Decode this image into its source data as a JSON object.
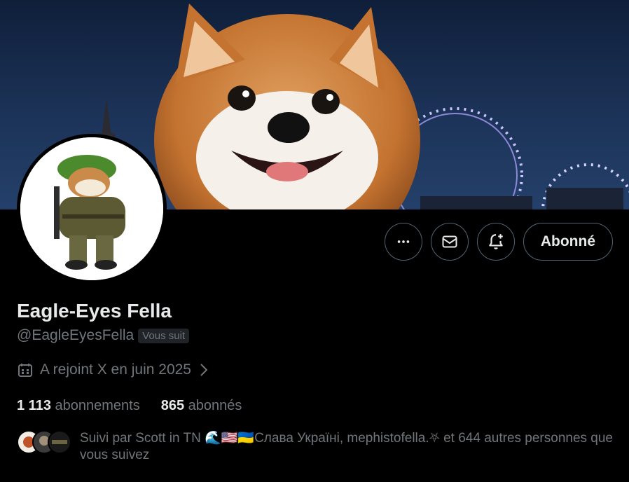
{
  "profile": {
    "name": "Eagle-Eyes Fella",
    "handle": "@EagleEyesFella",
    "follows_you": "Vous suit",
    "joined": "A rejoint X en juin 2025"
  },
  "actions": {
    "more_icon": "more-icon",
    "message_icon": "mail-icon",
    "notify_icon": "bell-plus-icon",
    "follow_label": "Abonné"
  },
  "stats": {
    "following_count": "1 113",
    "following_label": "abonnements",
    "followers_count": "865",
    "followers_label": "abonnés"
  },
  "followed_by": {
    "text": "Suivi par Scott in TN 🌊🇺🇸🇺🇦Слава Україні, mephistofella.⛧ et 644 autres personnes que vous suivez"
  },
  "colors": {
    "background": "#000000",
    "text_primary": "#e7e9ea",
    "text_secondary": "#71767b",
    "border": "#536471"
  }
}
